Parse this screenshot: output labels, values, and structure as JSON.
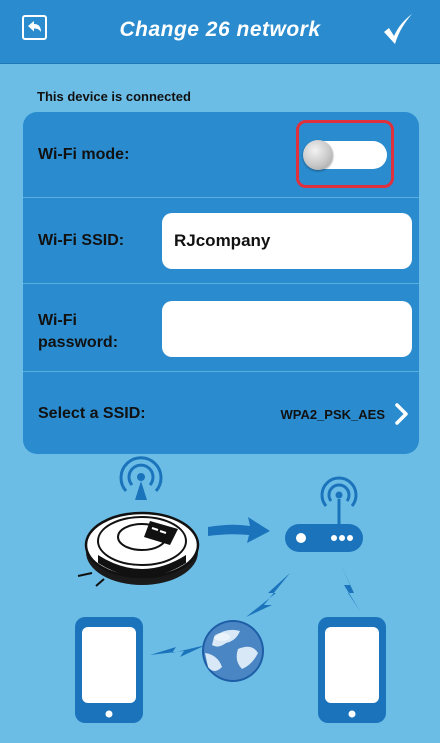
{
  "header": {
    "title": "Change 26 network",
    "back_icon": "back-arrow-icon",
    "confirm_icon": "checkmark-icon"
  },
  "status_text": "This device is connected",
  "form": {
    "wifi_mode": {
      "label": "Wi-Fi mode:",
      "state": "off"
    },
    "wifi_ssid": {
      "label": "Wi-Fi SSID:",
      "value": "RJcompany"
    },
    "wifi_password": {
      "label_line1": "Wi-Fi",
      "label_line2": "password:",
      "value": ""
    },
    "select_ssid": {
      "label": "Select a SSID:",
      "value": "WPA2_PSK_AES"
    }
  },
  "colors": {
    "background": "#6bbde6",
    "header": "#2a8ccf",
    "card": "#2a8ccf",
    "highlight": "#e0303d"
  }
}
